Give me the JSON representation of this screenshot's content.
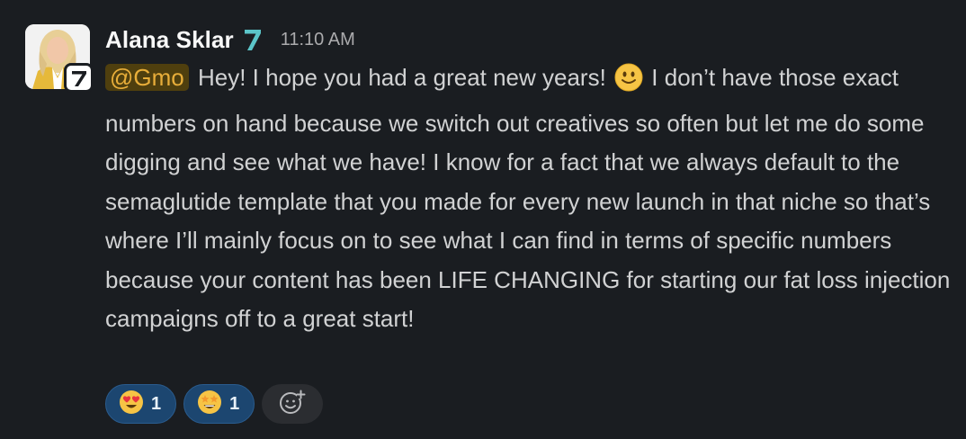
{
  "message": {
    "author": "Alana Sklar",
    "author_badge_icon": "seven-badge-icon",
    "timestamp": "11:10 AM",
    "mention": "@Gmo",
    "text_before_emoji": "Hey! I hope you had a great new years!",
    "inline_emoji": "slightly-smiling-face",
    "text_after_emoji": "I don’t have those exact numbers on hand because we switch out creatives so often but let me do some digging and see what we have! I know for a fact that we always default to the semaglutide template that you made for every new launch in that niche so that’s where I’ll mainly focus on to see what I can find in terms of specific numbers because your content has been LIFE CHANGING for starting our fat loss injection campaigns off to a great start!"
  },
  "reactions": [
    {
      "emoji": "heart-eyes",
      "count": "1"
    },
    {
      "emoji": "star-struck",
      "count": "1"
    }
  ],
  "add_reaction": {
    "icon": "add-reaction-icon"
  },
  "colors": {
    "background": "#1a1d21",
    "text": "#d1d2d3",
    "author": "#f8f8f8",
    "timestamp": "#ababad",
    "mention_bg": "#4f3f0e",
    "mention_text": "#e8ae3a",
    "reaction_bg": "#1c4670",
    "badge_teal": "#5bc5c9"
  }
}
